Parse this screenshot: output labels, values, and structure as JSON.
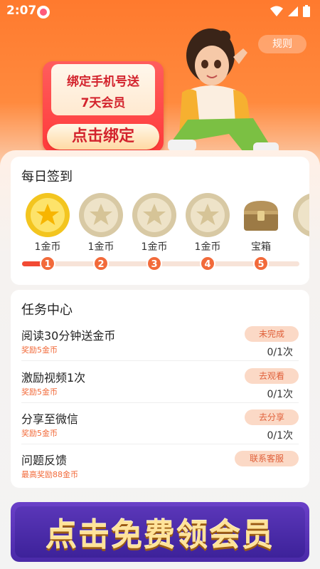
{
  "status_bar": {
    "time": "2:07"
  },
  "header": {
    "rules_label": "规则"
  },
  "promo": {
    "line1": "绑定手机号送",
    "line2": "7天会员",
    "button": "点击绑定"
  },
  "signin": {
    "title": "每日签到",
    "days": [
      {
        "label": "1金币",
        "icon": "coin-star-gold-icon",
        "step": "1"
      },
      {
        "label": "1金币",
        "icon": "coin-star-silver-icon",
        "step": "2"
      },
      {
        "label": "1金币",
        "icon": "coin-star-silver-icon",
        "step": "3"
      },
      {
        "label": "1金币",
        "icon": "coin-star-silver-icon",
        "step": "4"
      },
      {
        "label": "宝箱",
        "icon": "treasure-chest-icon",
        "step": "5"
      }
    ],
    "progress": 0.05
  },
  "tasks": {
    "title": "任务中心",
    "items": [
      {
        "title": "阅读30分钟送金币",
        "reward": "奖励5金币",
        "button": "未完成",
        "count": "0/1次"
      },
      {
        "title": "激励视频1次",
        "reward": "奖励5金币",
        "button": "去观看",
        "count": "0/1次"
      },
      {
        "title": "分享至微信",
        "reward": "奖励5金币",
        "button": "去分享",
        "count": "0/1次"
      },
      {
        "title": "问题反馈",
        "reward": "最高奖励88金币",
        "button": "联系客服"
      }
    ]
  },
  "banner": {
    "text": "点击免费领会员"
  },
  "colors": {
    "accent": "#f26a3a",
    "header_orange": "#ff7a2e",
    "promo_red": "#d3232d",
    "banner_purple": "#4a2aa8"
  }
}
